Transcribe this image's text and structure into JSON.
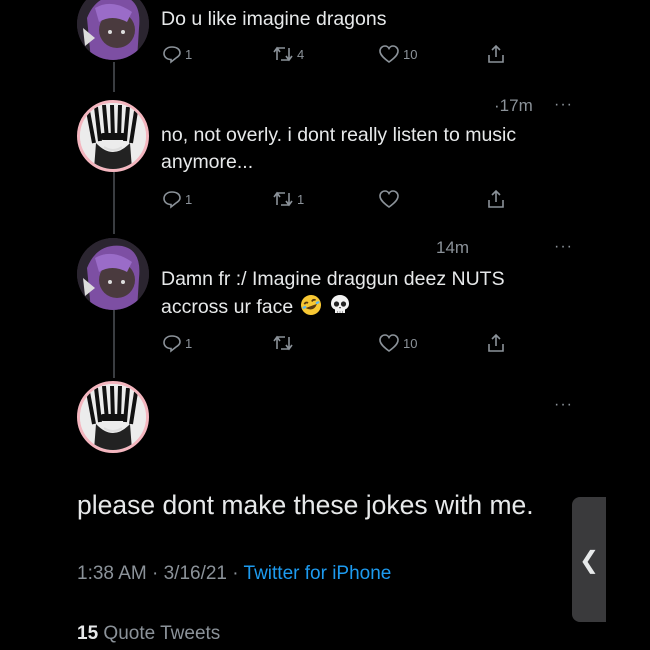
{
  "tweets": [
    {
      "text_lines": [
        "Do u like imagine dragons"
      ],
      "time": "",
      "replies": "1",
      "retweets": "4",
      "likes": "10"
    },
    {
      "text_lines": [
        "no, not overly. i dont really listen to music",
        "anymore..."
      ],
      "time": "·17m",
      "replies": "1",
      "retweets": "1",
      "likes": ""
    },
    {
      "text_lines": [
        "Damn fr :/ Imagine draggun deez NUTS",
        "accross ur face"
      ],
      "time": "14m",
      "replies": "1",
      "retweets": "",
      "likes": "10"
    }
  ],
  "main_tweet": {
    "text": "please dont make these jokes with me.",
    "time": "1:38 AM · 3/16/21 · ",
    "source": "Twitter for iPhone",
    "quote_count": "15",
    "quote_label": "Quote Tweets"
  },
  "more_label": "···",
  "back_chevron": "❮",
  "icons": {
    "reply": "reply-icon",
    "retweet": "retweet-icon",
    "like": "heart-icon",
    "share": "share-icon"
  },
  "colors": {
    "background": "#000000",
    "text": "#e7e9ea",
    "muted": "#8b9299",
    "link": "#1d9bf0",
    "avatar_ring": "#f4b6bf"
  }
}
